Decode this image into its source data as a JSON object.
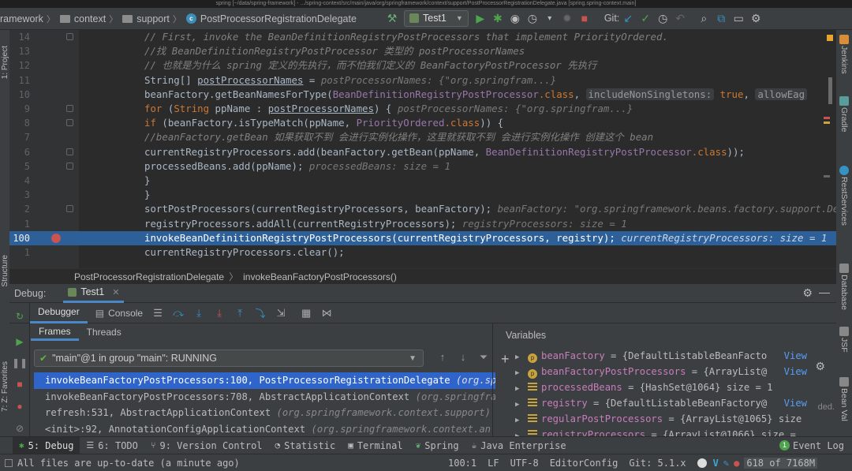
{
  "window": {
    "title": "spring [~/data/spring-framework] - .../spring-context/src/main/java/org/springframework/context/support/PostProcessorRegistrationDelegate.java [spring.spring-context.main]"
  },
  "nav": {
    "crumbs": [
      "ramework",
      "context",
      "support",
      "PostProcessorRegistrationDelegate"
    ],
    "run_config": "Test1",
    "git_label": "Git:"
  },
  "editor": {
    "lines": [
      {
        "num": "14",
        "code": [
          {
            "t": "// First, invoke the BeanDefinitionRegistryPostProcessors that implement PriorityOrdered.",
            "c": "com"
          }
        ]
      },
      {
        "num": "13",
        "code": [
          {
            "t": "//找 BeanDefinitionRegistryPostProcessor 类型的 postProcessorNames",
            "c": "com"
          }
        ]
      },
      {
        "num": "12",
        "code": [
          {
            "t": "// 也就是为什么 spring 定义的先执行，而不怕我们定义的 BeanFactoryPostProcessor 先执行",
            "c": "com"
          }
        ]
      },
      {
        "num": "11",
        "code": [
          {
            "t": "String[] ",
            "c": "plain"
          },
          {
            "t": "postProcessorNames",
            "c": "plain u"
          },
          {
            "t": " = ",
            "c": "plain"
          },
          {
            "t": "  postProcessorNames: {\"org.springfram...}",
            "c": "hint"
          }
        ]
      },
      {
        "num": "10",
        "code": [
          {
            "t": "        beanFactory.getBeanNamesForType(",
            "c": "plain"
          },
          {
            "t": "BeanDefinitionRegistryPostProcessor",
            "c": "var"
          },
          {
            "t": ".class",
            "c": "kw"
          },
          {
            "t": ", ",
            "c": "plain"
          },
          {
            "t": "includeNonSingletons:",
            "c": "chip"
          },
          {
            "t": " true",
            "c": "kw"
          },
          {
            "t": ", ",
            "c": "plain"
          },
          {
            "t": "allowEag",
            "c": "chip"
          }
        ]
      },
      {
        "num": "9",
        "code": [
          {
            "t": "for",
            "c": "kw"
          },
          {
            "t": " (",
            "c": "plain"
          },
          {
            "t": "String",
            "c": "kw"
          },
          {
            "t": " ppName : ",
            "c": "plain"
          },
          {
            "t": "postProcessorNames",
            "c": "plain u"
          },
          {
            "t": ") {  ",
            "c": "plain"
          },
          {
            "t": "postProcessorNames: {\"org.springfram...}",
            "c": "hint"
          }
        ]
      },
      {
        "num": "8",
        "code": [
          {
            "t": "    if",
            "c": "kw"
          },
          {
            "t": " (beanFactory.isTypeMatch(ppName, ",
            "c": "plain"
          },
          {
            "t": "PriorityOrdered",
            "c": "var"
          },
          {
            "t": ".class",
            "c": "kw"
          },
          {
            "t": ")) {",
            "c": "plain"
          }
        ]
      },
      {
        "num": "7",
        "code": [
          {
            "t": "        //beanFactory.getBean 如果获取不到 会进行实例化操作，这里就获取不到 会进行实例化操作 创建这个 bean",
            "c": "com"
          }
        ]
      },
      {
        "num": "6",
        "code": [
          {
            "t": "        currentRegistryProcessors.add(beanFactory.getBean(ppName, ",
            "c": "plain"
          },
          {
            "t": "BeanDefinitionRegistryPostProcessor",
            "c": "var"
          },
          {
            "t": ".class",
            "c": "kw"
          },
          {
            "t": "));",
            "c": "plain"
          }
        ]
      },
      {
        "num": "5",
        "code": [
          {
            "t": "        processedBeans.add(ppName);  ",
            "c": "plain"
          },
          {
            "t": "processedBeans:  size = 1",
            "c": "hint"
          }
        ]
      },
      {
        "num": "4",
        "code": [
          {
            "t": "    }",
            "c": "plain"
          }
        ]
      },
      {
        "num": "3",
        "code": [
          {
            "t": "}",
            "c": "plain"
          }
        ]
      },
      {
        "num": "2",
        "code": [
          {
            "t": "sortPostProcessors(currentRegistryProcessors, beanFactory);  ",
            "c": "plain"
          },
          {
            "t": "beanFactory: \"org.springframework.beans.factory.support.De",
            "c": "hint"
          }
        ]
      },
      {
        "num": "1",
        "code": [
          {
            "t": "registryProcessors.addAll(currentRegistryProcessors);  ",
            "c": "plain"
          },
          {
            "t": "registryProcessors:  size = 1",
            "c": "hint"
          }
        ]
      },
      {
        "num": "100",
        "current": true,
        "code": [
          {
            "t": "invokeBeanDefinitionRegistryPostProcessors(currentRegistryProcessors, registry);  ",
            "c": "plain"
          },
          {
            "t": "currentRegistryProcessors:  size = 1",
            "c": "hint"
          }
        ]
      },
      {
        "num": "1",
        "code": [
          {
            "t": "currentRegistryProcessors.clear();",
            "c": "plain"
          }
        ]
      }
    ],
    "breadcrumb": [
      "PostProcessorRegistrationDelegate",
      "invokeBeanFactoryPostProcessors()"
    ]
  },
  "left_stripe": [
    "1: Project",
    "Structure",
    "7: Z: Favorites"
  ],
  "right_stripe": [
    "Jenkins",
    "Gradle",
    "RestServices",
    "Database",
    "JSF",
    "Bean Val"
  ],
  "debug": {
    "label": "Debug:",
    "session_tab": "Test1",
    "tabs": {
      "debugger": "Debugger",
      "console": "Console"
    },
    "frames_tab": "Frames",
    "threads_tab": "Threads",
    "thread_select": "\"main\"@1 in group \"main\": RUNNING",
    "frames": [
      {
        "text": "invokeBeanFactoryPostProcessors:100, PostProcessorRegistrationDelegate",
        "pkg": "(org.sp",
        "selected": true
      },
      {
        "text": "invokeBeanFactoryPostProcessors:708, AbstractApplicationContext",
        "pkg": "(org.springfra"
      },
      {
        "text": "refresh:531, AbstractApplicationContext",
        "pkg": "(org.springframework.context.support)"
      },
      {
        "text": "<init>:92, AnnotationConfigApplicationContext",
        "pkg": "(org.springframework.context.an"
      }
    ],
    "variables_title": "Variables",
    "variables": [
      {
        "kind": "p",
        "name": "beanFactory",
        "value": " = {DefaultListableBeanFacto",
        "extra": "",
        "view": "View"
      },
      {
        "kind": "p",
        "name": "beanFactoryPostProcessors",
        "value": " = {ArrayList@",
        "extra": "",
        "view": "View"
      },
      {
        "kind": "f",
        "name": "processedBeans",
        "value": " = {HashSet@1064}",
        "extra": "  size = 1",
        "view": ""
      },
      {
        "kind": "f",
        "name": "registry",
        "value": " = {DefaultListableBeanFactory@",
        "extra": "",
        "view": "View"
      },
      {
        "kind": "f",
        "name": "regularPostProcessors",
        "value": " = {ArrayList@1065}",
        "extra": "  size",
        "view": ""
      },
      {
        "kind": "f",
        "name": "registryProcessors",
        "value": " = {ArrayList@1066}",
        "extra": "  size =",
        "view": ""
      }
    ],
    "side_note": "ded."
  },
  "tool_windows": [
    {
      "label": "5: Debug",
      "selected": true,
      "icon": "bug-icon"
    },
    {
      "label": "6: TODO",
      "icon": "list-icon"
    },
    {
      "label": "9: Version Control",
      "icon": "vcs-icon"
    },
    {
      "label": "Statistic",
      "icon": "clock-icon"
    },
    {
      "label": "Terminal",
      "icon": "terminal-icon"
    },
    {
      "label": "Spring",
      "icon": "leaf-icon"
    },
    {
      "label": "Java Enterprise",
      "icon": "java-icon"
    }
  ],
  "event_log": {
    "label": "Event Log",
    "count": "1"
  },
  "status": {
    "message": "All files are up-to-date (a minute ago)",
    "position": "100:1",
    "line_sep": "LF",
    "encoding": "UTF-8",
    "editorconfig": "EditorConfig",
    "git": "Git: 5.1.x",
    "memory": "618 of 7168M"
  },
  "colors": {
    "accent": "#4a88c7",
    "selection": "#2f65ca",
    "breakpoint": "#c75450",
    "run": "#4ea44c"
  }
}
